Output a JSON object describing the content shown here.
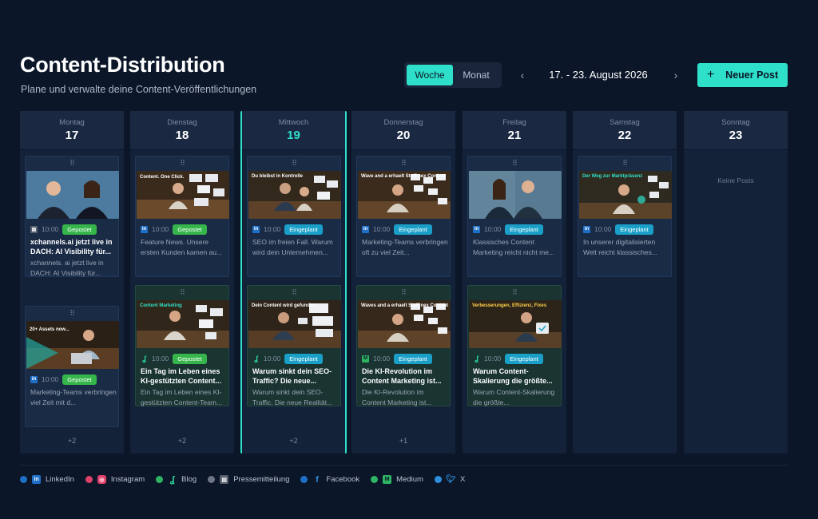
{
  "header": {
    "title": "Content-Distribution",
    "subtitle": "Plane und verwalte deine Content-Veröffentlichungen",
    "view_week": "Woche",
    "view_month": "Monat",
    "prev": "‹",
    "next": "›",
    "date_range": "17. - 23. August 2026",
    "new_post_plus": "+",
    "new_post_label": "Neuer Post"
  },
  "days": [
    {
      "name": "Montag",
      "num": "17",
      "more": "+2"
    },
    {
      "name": "Dienstag",
      "num": "18",
      "more": "+2"
    },
    {
      "name": "Mittwoch",
      "num": "19",
      "more": "+2"
    },
    {
      "name": "Donnerstag",
      "num": "20",
      "more": "+1"
    },
    {
      "name": "Freitag",
      "num": "21"
    },
    {
      "name": "Samstag",
      "num": "22"
    },
    {
      "name": "Sonntag",
      "num": "23",
      "empty": "Keine Posts"
    }
  ],
  "status_colors": {
    "posted": "#36b54b",
    "planned": "#1aa0c8",
    "accent": "#2ee0c9"
  },
  "cards": {
    "mon_1": {
      "platform": "press-icon",
      "time": "10:00",
      "status": "Gepostet",
      "title": "xchannels.ai jetzt live in DACH: AI Visibility für...",
      "excerpt": "xchannels. ai jetzt live in DACH: AI Visibility für..."
    },
    "mon_2": {
      "platform": "linkedin-icon",
      "time": "10:00",
      "status": "Gepostet",
      "excerpt": "Marketing-Teams verbringen viel Zeit mit d...",
      "thumb_text": "20+ Assets now..."
    },
    "tue_1": {
      "platform": "linkedin-icon",
      "time": "10:00",
      "status": "Gepostet",
      "excerpt": "Feature News. Unsere ersten Kunden kamen au...",
      "thumb_text": "Content. One Click."
    },
    "tue_2": {
      "platform": "blog-icon",
      "time": "10:00",
      "status": "Gepostet",
      "title": "Ein Tag im Leben eines KI-gestützten Content...",
      "excerpt": "Ein Tag im Leben eines KI-gestützten Content-Team...",
      "thumb_text": "Content Marketing"
    },
    "wed_1": {
      "platform": "linkedin-icon",
      "time": "10:00",
      "status": "Eingeplant",
      "excerpt": "SEO im freien Fall. Warum wird dein Unternehmen...",
      "thumb_text": "Du bleibst in Kontrolle"
    },
    "wed_2": {
      "platform": "blog-icon",
      "time": "10:00",
      "status": "Eingeplant",
      "title": "Warum sinkt dein SEO-Traffic? Die neue...",
      "excerpt": "Warum sinkt dein SEO-Traffic. Die neue Realität...",
      "thumb_text": "Dein Content wird gefunden"
    },
    "thu_1": {
      "platform": "linkedin-icon",
      "time": "10:00",
      "status": "Eingeplant",
      "excerpt": "Marketing-Teams verbringen oft zu viel Zeit...",
      "thumb_text": "Wave and a erhaelt Stuff nex Content"
    },
    "thu_2": {
      "platform": "medium-icon",
      "time": "10:00",
      "status": "Eingeplant",
      "title": "Die KI-Revolution im Content Marketing ist...",
      "excerpt": "Die KI-Revolution im Content Marketing ist...",
      "thumb_text": "Waves and a erhaelt Stuff nex Content"
    },
    "fri_1": {
      "platform": "linkedin-icon",
      "time": "10:00",
      "status": "Eingeplant",
      "excerpt": "Klassisches Content Marketing reicht nicht me..."
    },
    "fri_2": {
      "platform": "blog-icon",
      "time": "10:00",
      "status": "Eingeplant",
      "title": "Warum Content-Skalierung die größte...",
      "excerpt": "Warum Content-Skalierung die größte...",
      "thumb_text": "Verbesserungen, Effizienz, Fixes"
    },
    "sat_1": {
      "platform": "linkedin-icon",
      "time": "10:00",
      "status": "Eingeplant",
      "excerpt": "In unserer digitalisierten Welt reicht klassisches...",
      "thumb_text": "Der Weg zur Marktpräsenz"
    }
  },
  "legend": [
    {
      "label": "LinkedIn",
      "dot": "#1e70c7",
      "icon": "linkedin-icon"
    },
    {
      "label": "Instagram",
      "dot": "#e0416b",
      "icon": "instagram-icon"
    },
    {
      "label": "Blog",
      "dot": "#2fb463",
      "icon": "blog-icon"
    },
    {
      "label": "Pressemitteilung",
      "dot": "#6c7686",
      "icon": "press-icon"
    },
    {
      "label": "Facebook",
      "dot": "#1e70c7",
      "icon": "facebook-icon"
    },
    {
      "label": "Medium",
      "dot": "#2fb463",
      "icon": "medium-icon"
    },
    {
      "label": "X",
      "dot": "#2f8fe0",
      "icon": "x-icon"
    }
  ]
}
